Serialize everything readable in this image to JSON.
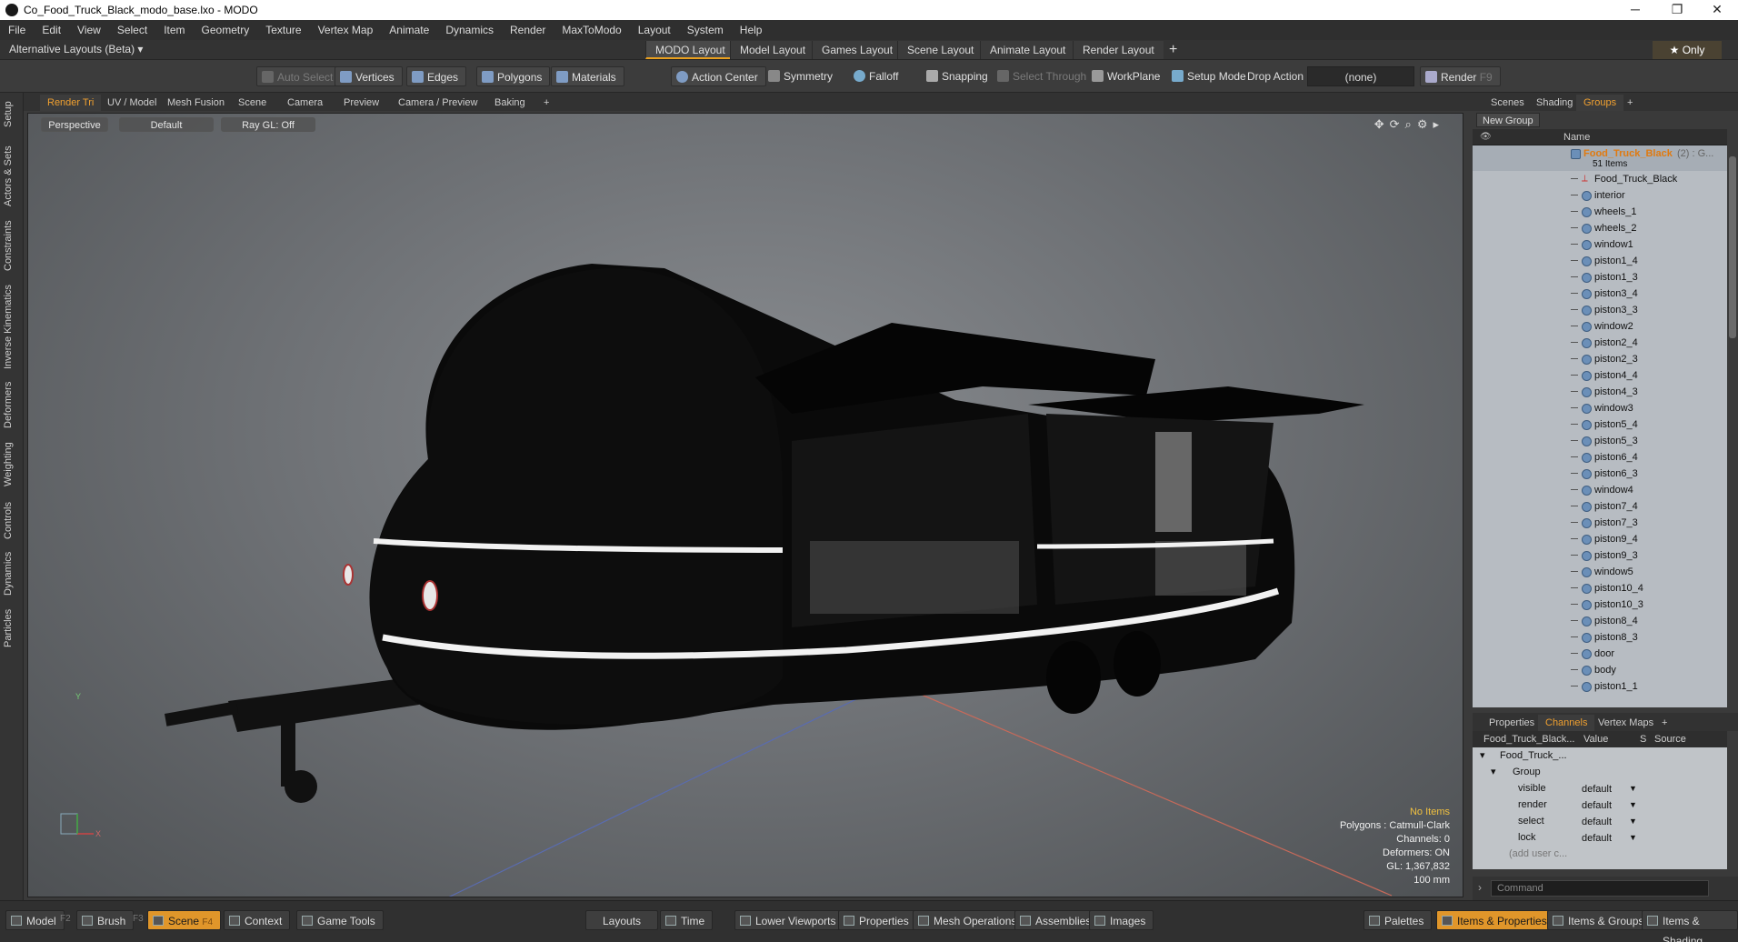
{
  "window": {
    "title": "Co_Food_Truck_Black_modo_base.lxo - MODO",
    "minimize": "─",
    "maximize": "❐",
    "close": "✕"
  },
  "menu": [
    "File",
    "Edit",
    "View",
    "Select",
    "Item",
    "Geometry",
    "Texture",
    "Vertex Map",
    "Animate",
    "Dynamics",
    "Render",
    "MaxToModo",
    "Layout",
    "System",
    "Help"
  ],
  "layoutbar": {
    "alternative": "Alternative Layouts (Beta) ▾",
    "tabs": [
      "MODO Layout",
      "Model Layout",
      "Games Layout",
      "Scene Layout",
      "Animate Layout",
      "Render Layout"
    ],
    "add": "+",
    "only": "★ Only"
  },
  "toolbar": {
    "auto_select": "Auto Select",
    "vertices": "Vertices",
    "edges": "Edges",
    "polygons": "Polygons",
    "materials": "Materials",
    "action_center": "Action Center",
    "symmetry": "Symmetry",
    "falloff": "Falloff",
    "snapping": "Snapping",
    "select_through": "Select Through",
    "workplane": "WorkPlane",
    "setup_mode": "Setup Mode",
    "drop_action": "Drop Action",
    "drop_value": "(none)",
    "render": "Render",
    "render_key": "F9"
  },
  "left_tabs": [
    "Setup",
    "Actors & Sets",
    "Constraints",
    "Inverse Kinematics",
    "Deformers",
    "Weighting",
    "Controls",
    "Dynamics",
    "Particles"
  ],
  "viewport_tabs": [
    "Render Tri",
    "UV / Model",
    "Mesh Fusion",
    "Scene",
    "Camera",
    "Preview",
    "Camera / Preview",
    "Baking",
    "+"
  ],
  "viewport": {
    "perspective": "Perspective",
    "default": "Default",
    "raygl": "Ray GL: Off",
    "stats": {
      "items": "No Items",
      "polygons": "Polygons : Catmull-Clark",
      "channels": "Channels: 0",
      "deformers": "Deformers: ON",
      "gl": "GL: 1,367,832",
      "size": "100 mm"
    },
    "axis_y": "Y",
    "axis_x": "X"
  },
  "right_tabs": [
    "Scenes",
    "Shading",
    "Groups",
    "+"
  ],
  "groups": {
    "new_group": "New Group",
    "col_name": "Name",
    "root_name": "Food_Truck_Black",
    "root_suffix": "(2) : G...",
    "root_count": "51 Items",
    "items": [
      "Food_Truck_Black",
      "interior",
      "wheels_1",
      "wheels_2",
      "window1",
      "piston1_4",
      "piston1_3",
      "piston3_4",
      "piston3_3",
      "window2",
      "piston2_4",
      "piston2_3",
      "piston4_4",
      "piston4_3",
      "window3",
      "piston5_4",
      "piston5_3",
      "piston6_4",
      "piston6_3",
      "window4",
      "piston7_4",
      "piston7_3",
      "piston9_4",
      "piston9_3",
      "window5",
      "piston10_4",
      "piston10_3",
      "piston8_4",
      "piston8_3",
      "door",
      "body",
      "piston1_1"
    ]
  },
  "channel_tabs": [
    "Properties",
    "Channels",
    "Vertex Maps",
    "+"
  ],
  "channels": {
    "col_name": "Food_Truck_Black...",
    "col_value": "Value",
    "col_s": "S",
    "col_source": "Source",
    "item": "Food_Truck_...",
    "group": "Group",
    "rows": [
      {
        "name": "visible",
        "value": "default"
      },
      {
        "name": "render",
        "value": "default"
      },
      {
        "name": "select",
        "value": "default"
      },
      {
        "name": "lock",
        "value": "default"
      }
    ],
    "add_user": "(add user c..."
  },
  "command_placeholder": "Command",
  "bottombar": {
    "model": "Model",
    "f2": "F2",
    "brush": "Brush",
    "f3": "F3",
    "scene": "Scene",
    "f4": "F4",
    "context": "Context",
    "game_tools": "Game Tools",
    "layouts": "Layouts",
    "time": "Time",
    "lower_viewports": "Lower Viewports",
    "properties": "Properties",
    "mesh_operations": "Mesh Operations",
    "assemblies": "Assemblies",
    "images": "Images",
    "palettes": "Palettes",
    "items_properties": "Items & Properties",
    "items_groups": "Items & Groups",
    "items_shading": "Items & Shading"
  },
  "colors": {
    "accent": "#e0962a",
    "viewport_bg": "#7a7d81",
    "group_list_bg": "#b7bcc2"
  }
}
